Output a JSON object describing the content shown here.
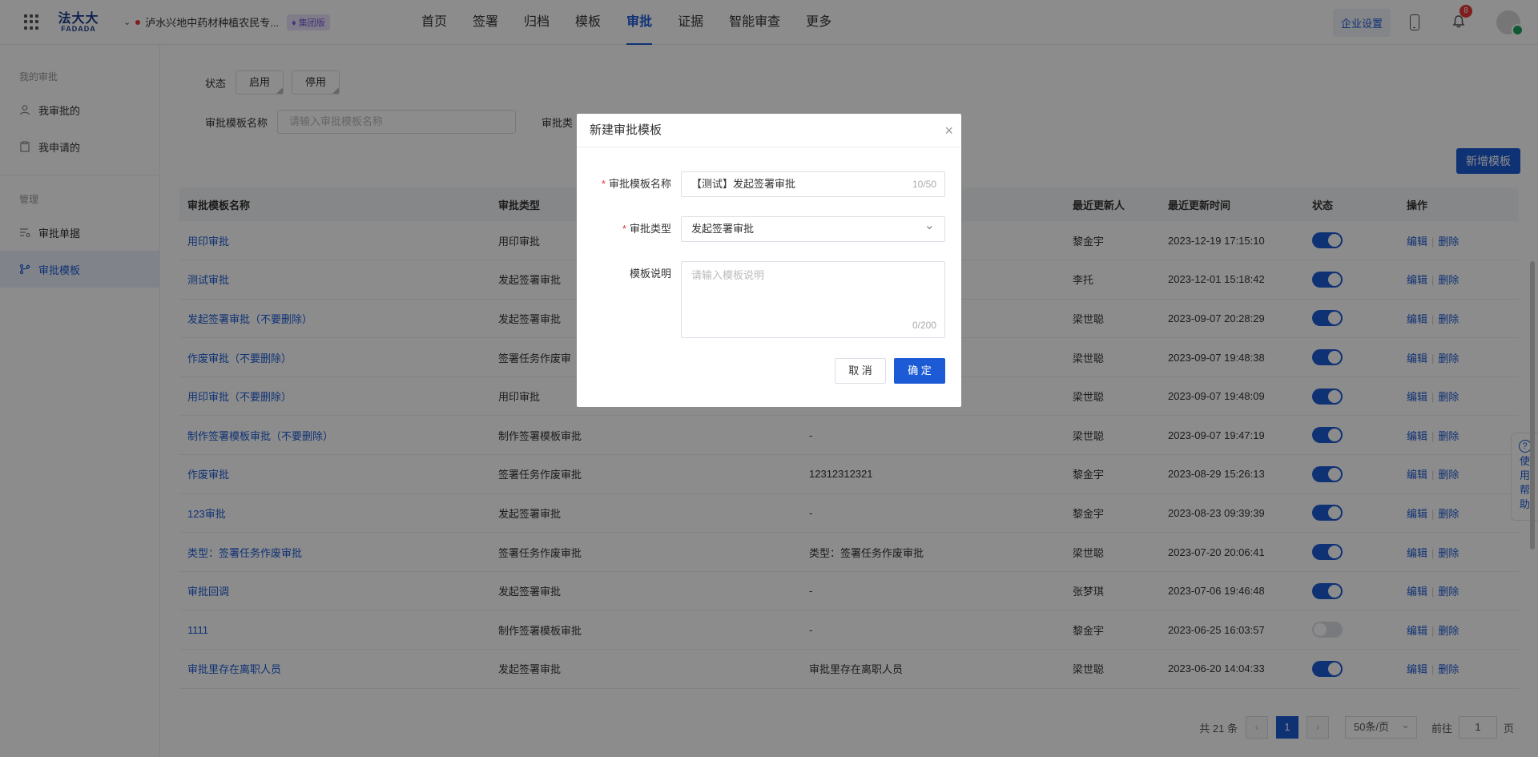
{
  "header": {
    "logo_cn": "法大大",
    "logo_en": "FADADA",
    "company": "泸水兴地中药材种植农民专...",
    "company_badge": "集团版",
    "nav": [
      "首页",
      "签署",
      "归档",
      "模板",
      "审批",
      "证据",
      "智能审查",
      "更多"
    ],
    "active_nav": "审批",
    "enterprise_settings": "企业设置",
    "notifications": "8"
  },
  "sidebar": {
    "group1": "我的审批",
    "items1": [
      "我审批的",
      "我申请的"
    ],
    "group2": "管理",
    "items2": [
      "审批单据",
      "审批模板"
    ],
    "active": "审批模板"
  },
  "filters": {
    "status_label": "状态",
    "status_options": [
      "启用",
      "停用"
    ],
    "name_label": "审批模板名称",
    "name_placeholder": "请输入审批模板名称",
    "type_label": "审批类"
  },
  "new_button": "新增模板",
  "table": {
    "headers": [
      "审批模板名称",
      "审批类型",
      "",
      "最近更新人",
      "最近更新时间",
      "状态",
      "操作"
    ],
    "rows": [
      {
        "name": "用印审批",
        "type": "用印审批",
        "desc": "",
        "updater": "黎金宇",
        "time": "2023-12-19 17:15:10",
        "on": true
      },
      {
        "name": "测试审批",
        "type": "发起签署审批",
        "desc": "",
        "updater": "李托",
        "time": "2023-12-01 15:18:42",
        "on": true
      },
      {
        "name": "发起签署审批（不要删除）",
        "type": "发起签署审批",
        "desc": "",
        "updater": "梁世聪",
        "time": "2023-09-07 20:28:29",
        "on": true
      },
      {
        "name": "作废审批（不要删除）",
        "type": "签署任务作废审",
        "desc": "",
        "updater": "梁世聪",
        "time": "2023-09-07 19:48:38",
        "on": true
      },
      {
        "name": "用印审批（不要删除）",
        "type": "用印审批",
        "desc": "",
        "updater": "梁世聪",
        "time": "2023-09-07 19:48:09",
        "on": true
      },
      {
        "name": "制作签署模板审批（不要删除）",
        "type": "制作签署模板审批",
        "desc": "-",
        "updater": "梁世聪",
        "time": "2023-09-07 19:47:19",
        "on": true
      },
      {
        "name": "作废审批",
        "type": "签署任务作废审批",
        "desc": "12312312321",
        "updater": "黎金宇",
        "time": "2023-08-29 15:26:13",
        "on": true
      },
      {
        "name": "123审批",
        "type": "发起签署审批",
        "desc": "-",
        "updater": "黎金宇",
        "time": "2023-08-23 09:39:39",
        "on": true
      },
      {
        "name": "类型：签署任务作废审批",
        "type": "签署任务作废审批",
        "desc": "类型：签署任务作废审批",
        "updater": "梁世聪",
        "time": "2023-07-20 20:06:41",
        "on": true
      },
      {
        "name": "审批回调",
        "type": "发起签署审批",
        "desc": "-",
        "updater": "张梦琪",
        "time": "2023-07-06 19:46:48",
        "on": true
      },
      {
        "name": "1111",
        "type": "制作签署模板审批",
        "desc": "-",
        "updater": "黎金宇",
        "time": "2023-06-25 16:03:57",
        "on": false
      },
      {
        "name": "审批里存在离职人员",
        "type": "发起签署审批",
        "desc": "审批里存在离职人员",
        "updater": "梁世聪",
        "time": "2023-06-20 14:04:33",
        "on": true
      }
    ],
    "op_edit": "编辑",
    "op_delete": "删除"
  },
  "pager": {
    "total": "共 21 条",
    "page": "1",
    "page_size": "50条/页",
    "goto_label": "前往",
    "goto_value": "1",
    "goto_unit": "页"
  },
  "help": {
    "q": "?",
    "label": "使用帮助"
  },
  "modal": {
    "title": "新建审批模板",
    "name_label": "审批模板名称",
    "name_value": "【测试】发起签署审批",
    "name_count": "10/50",
    "type_label": "审批类型",
    "type_value": "发起签署审批",
    "desc_label": "模板说明",
    "desc_placeholder": "请输入模板说明",
    "desc_count": "0/200",
    "cancel": "取 消",
    "ok": "确 定"
  }
}
